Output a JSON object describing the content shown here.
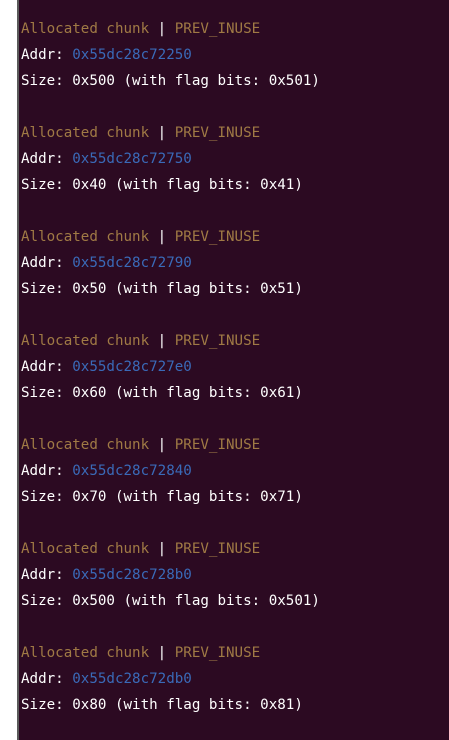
{
  "colors": {
    "background": "#2c0a22",
    "chunk_label": "#a07a45",
    "address": "#3a6ab8",
    "text": "#ffffff"
  },
  "chunks": [
    {
      "status": "Allocated chunk",
      "separator": "|",
      "flag": "PREV_INUSE",
      "addr_label": "Addr:",
      "addr": "0x55dc28c72250",
      "size_line": "Size: 0x500 (with flag bits: 0x501)"
    },
    {
      "status": "Allocated chunk",
      "separator": "|",
      "flag": "PREV_INUSE",
      "addr_label": "Addr:",
      "addr": "0x55dc28c72750",
      "size_line": "Size: 0x40 (with flag bits: 0x41)"
    },
    {
      "status": "Allocated chunk",
      "separator": "|",
      "flag": "PREV_INUSE",
      "addr_label": "Addr:",
      "addr": "0x55dc28c72790",
      "size_line": "Size: 0x50 (with flag bits: 0x51)"
    },
    {
      "status": "Allocated chunk",
      "separator": "|",
      "flag": "PREV_INUSE",
      "addr_label": "Addr:",
      "addr": "0x55dc28c727e0",
      "size_line": "Size: 0x60 (with flag bits: 0x61)"
    },
    {
      "status": "Allocated chunk",
      "separator": "|",
      "flag": "PREV_INUSE",
      "addr_label": "Addr:",
      "addr": "0x55dc28c72840",
      "size_line": "Size: 0x70 (with flag bits: 0x71)"
    },
    {
      "status": "Allocated chunk",
      "separator": "|",
      "flag": "PREV_INUSE",
      "addr_label": "Addr:",
      "addr": "0x55dc28c728b0",
      "size_line": "Size: 0x500 (with flag bits: 0x501)"
    },
    {
      "status": "Allocated chunk",
      "separator": "|",
      "flag": "PREV_INUSE",
      "addr_label": "Addr:",
      "addr": "0x55dc28c72db0",
      "size_line": "Size: 0x80 (with flag bits: 0x81)"
    }
  ]
}
